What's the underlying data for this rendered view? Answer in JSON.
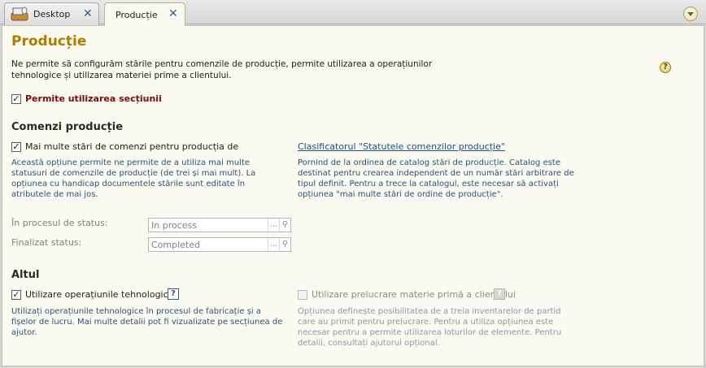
{
  "tabs": [
    {
      "label": "Desktop",
      "icon": "desktop-icon"
    },
    {
      "label": "Producție",
      "active": true
    }
  ],
  "page": {
    "title": "Producție",
    "description": "Ne permite să configurăm stările pentru comenzile de producție, permite utilizarea a operațiunilor tehnologice și utilizarea materiei prime a clientului.",
    "enable_label": "Permite utilizarea secțiunii",
    "enable_checked": true
  },
  "orders": {
    "heading": "Comenzi producție",
    "multi_label": "Mai multe stări de comenzi pentru producția de",
    "multi_checked": true,
    "multi_desc": "Această opțiune permite ne permite de a utiliza mai multe statusuri de comenzile de producție (de trei și mai mult). La opțiunea cu handicap documentele stările sunt editate în atributele de mai jos.",
    "catalog_link": "Clasificatorul \"Statutele comenzilor producție\"",
    "catalog_desc": "Pornind de la ordinea de catalog stări de producție. Catalog este destinat pentru crearea independent de un număr stări arbitrare de tipul definit. Pentru a trece la catalogul, este necesar să activați opțiunea \"mai multe stări de ordine de producție\".",
    "in_process_label": "În procesul de status:",
    "in_process_value": "In process",
    "finalized_label": "Finalizat status:",
    "finalized_value": "Completed",
    "select_btn": "...",
    "open_icon": "magnifier-icon"
  },
  "other": {
    "heading": "Altul",
    "tech_label": "Utilizare operațiunile tehnologice",
    "tech_checked": true,
    "tech_desc": "Utilizați operațiunile tehnologice în procesul de fabricație și a fișelor de lucru. Mai multe detalii pot fi vizualizate pe secțiunea de ajutor.",
    "raw_label": "Utilizare prelucrare materie primă a clientului",
    "raw_checked": false,
    "raw_desc": "Opțiunea definește posibilitatea de a treia inventarelor de partid care au primit pentru prelucrare. Pentru a utiliza opțiunea este necesar pentru a permite utilizarea loturilor de elemente. Pentru detalii, consultați ajutorul opțional.",
    "help_mark": "?"
  },
  "help_mark": "?",
  "colors": {
    "title": "#b07c00",
    "accent_red": "#7a0a0a",
    "link": "#1f4c8a",
    "desc_blue": "#2d4f7c"
  }
}
